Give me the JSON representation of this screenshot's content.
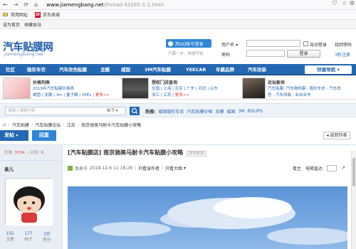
{
  "browser": {
    "url": "www.jiamengbang.net/thread-43265-1-1.html",
    "url_host": "www.jiamengbang.net",
    "url_path": "/thread-43265-1-1.html"
  },
  "bookmarks": [
    "常用网址",
    "京东商城"
  ],
  "toolbar": {
    "set_home": "设为首页",
    "bookmark": "收藏本站"
  },
  "header": {
    "logo_title": "汽车贴膜网",
    "logo_domain": "jiamengbang.net",
    "qq_login": "用QQ帐号登录",
    "qq_hint": "只需一步，快速开始",
    "username_label": "用户名",
    "password_label": "密码",
    "auto_login": "自动登录",
    "forgot_password": "找回密码",
    "login_button": "登录",
    "register": "注册",
    "register_3sec": "3秒注册"
  },
  "nav": {
    "items": [
      "社区",
      "隐形车衣",
      "汽车改色贴膜",
      "龙膜",
      "威固",
      "3M汽车贴膜",
      "YEECAR",
      "车膜品牌",
      "汽车改装"
    ],
    "quick_nav": "快捷导航"
  },
  "promo": {
    "block1": {
      "title": "价格列表",
      "line1": "2019年汽车贴膜价格表",
      "line2_a": "威固",
      "line2_b": "龙膜",
      "line2_c": "3m",
      "line2_d": "量子膜",
      "line2_e": "XPEL",
      "line2_more": "更多>>"
    },
    "block2": {
      "title": "授权门店查询",
      "cities_row1": [
        "全国",
        "上海",
        "北京",
        "广东",
        "河北",
        "山东"
      ],
      "cities_row2": [
        "浙江",
        "江苏"
      ],
      "more": "更多>>"
    },
    "block3": {
      "title": "论坛板块",
      "line1_a": "汽车贴膜",
      "line1_b": "汽车隔热膜",
      "line1_c": "隐形车衣",
      "line1_d": "汽车改",
      "line2_a": "色",
      "line2_b": "汽车改装",
      "line2_c": "业余合作"
    }
  },
  "search": {
    "placeholder": "请输入搜索内容",
    "type": "帖子",
    "hot_label": "热搜:",
    "hot_terms": [
      "威固隐形车衣",
      "汽车贴膜价格",
      "龙膜",
      "威固",
      "3M",
      "ROLIPS"
    ]
  },
  "breadcrumb": [
    "汽车贴膜",
    "汽车贴膜论坛",
    "江苏",
    "南京驰美马耐卡汽车贴膜小攻略"
  ],
  "actions": {
    "post": "发帖",
    "reply": "回复",
    "back_list": "返回列表"
  },
  "thread": {
    "views_label": "查看:",
    "views": "3724",
    "replies_label": "回复:",
    "replies": "0",
    "title": "[汽车贴膜店] 南京驰美马耐卡汽车贴膜小攻略",
    "copy_link": "[复制链接]",
    "posted_prefix": "发表于",
    "posted_at": "2018-12-6 11:18:28",
    "only_author": "只看该作者",
    "only_large": "只看大图",
    "floor": "楼主",
    "jump_label": "电梯直达"
  },
  "user": {
    "name": "袁儿",
    "topics": "155",
    "topics_label": "主题",
    "posts": "177",
    "posts_label": "帖子",
    "credits": "3万",
    "credits_label": "积分"
  },
  "colors": {
    "brand_blue": "#2468b3",
    "accent_blue": "#2f86d5"
  }
}
